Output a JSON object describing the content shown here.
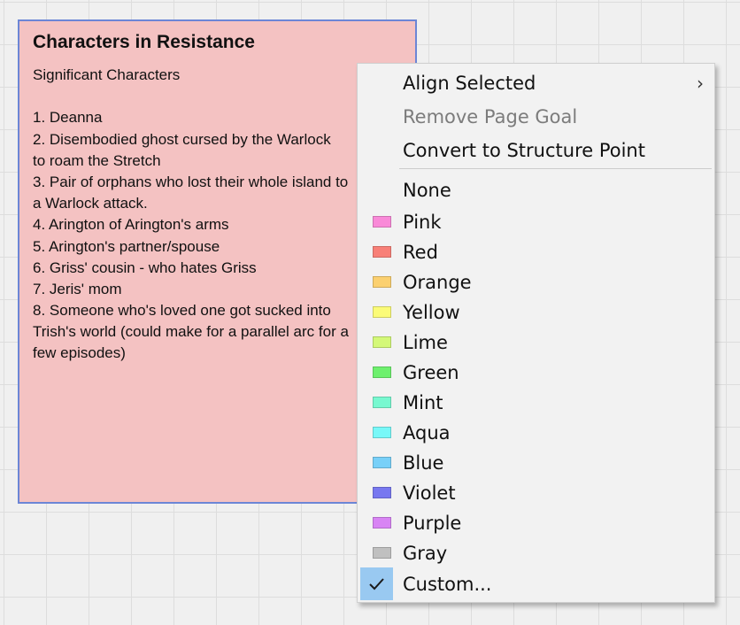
{
  "card": {
    "title": "Characters in Resistance",
    "lines": [
      "Significant Characters",
      "",
      "1. Deanna",
      "2. Disembodied ghost cursed by the Warlock",
      "to roam the Stretch",
      "3. Pair of orphans who lost their whole island to",
      "a Warlock attack.",
      "4. Arington of Arington's arms",
      "5. Arington's partner/spouse",
      "6. Griss' cousin - who hates Griss",
      "7. Jeris' mom",
      "8. Someone who's loved one got sucked into",
      "Trish's world (could make for a parallel arc for a",
      "few episodes)"
    ],
    "background_color": "#f4c2c2",
    "border_color": "#6c86d6"
  },
  "context_menu": {
    "actions": [
      {
        "label": "Align Selected",
        "has_submenu": true,
        "enabled": true,
        "submenu_icon": "chevron-right-icon"
      },
      {
        "label": "Remove Page Goal",
        "has_submenu": false,
        "enabled": false
      },
      {
        "label": "Convert to Structure Point",
        "has_submenu": false,
        "enabled": true
      }
    ],
    "colors": [
      {
        "label": "None",
        "color": null,
        "checked": false
      },
      {
        "label": "Pink",
        "color": "#f98ad8",
        "checked": false
      },
      {
        "label": "Red",
        "color": "#f88078",
        "checked": false
      },
      {
        "label": "Orange",
        "color": "#fbd070",
        "checked": false
      },
      {
        "label": "Yellow",
        "color": "#fbfb78",
        "checked": false
      },
      {
        "label": "Lime",
        "color": "#d4f878",
        "checked": false
      },
      {
        "label": "Green",
        "color": "#6ef06e",
        "checked": false
      },
      {
        "label": "Mint",
        "color": "#78f8d0",
        "checked": false
      },
      {
        "label": "Aqua",
        "color": "#78f8f8",
        "checked": false
      },
      {
        "label": "Blue",
        "color": "#78d0f8",
        "checked": false
      },
      {
        "label": "Violet",
        "color": "#7878f0",
        "checked": false
      },
      {
        "label": "Purple",
        "color": "#d884f4",
        "checked": false
      },
      {
        "label": "Gray",
        "color": "#c0c0c0",
        "checked": false
      },
      {
        "label": "Custom...",
        "color": null,
        "checked": true,
        "check_icon": "checkmark-icon",
        "check_bg": "#99c9f1"
      }
    ]
  }
}
